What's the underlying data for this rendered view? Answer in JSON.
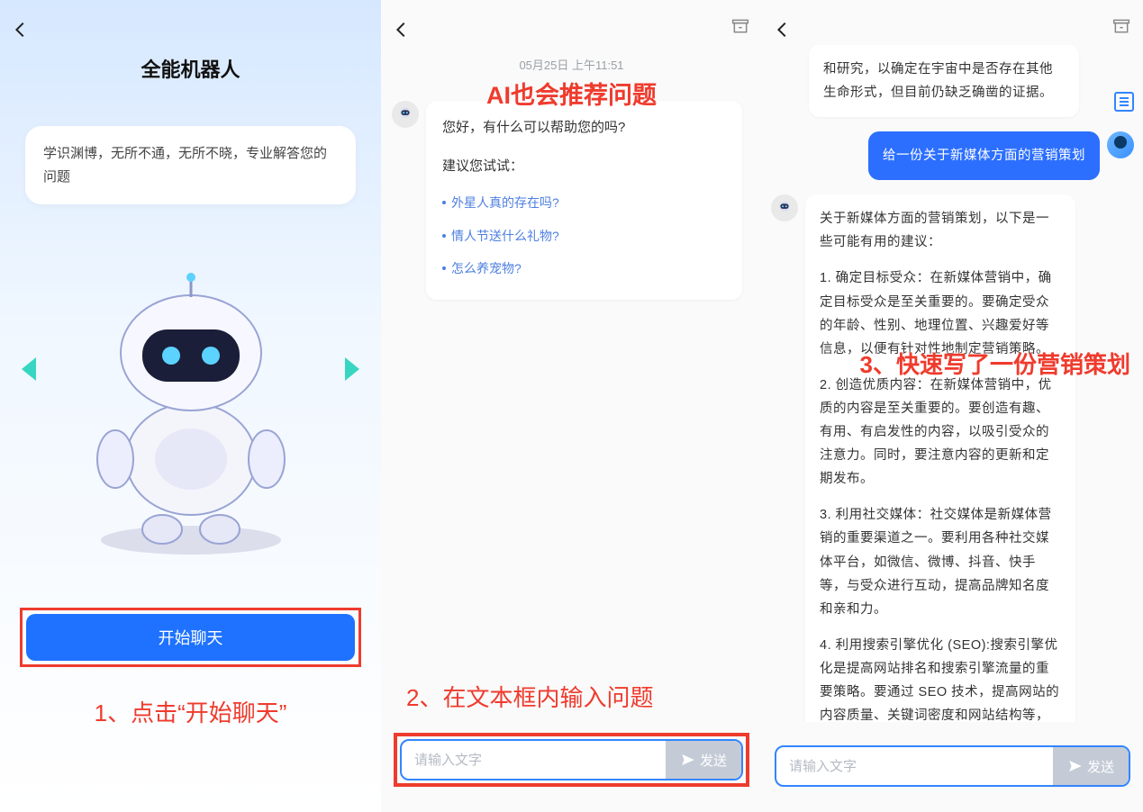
{
  "panel1": {
    "title": "全能机器人",
    "intro": "学识渊博，无所不通，无所不晓，专业解答您的问题",
    "start_button": "开始聊天",
    "caption": "1、点击“开始聊天”"
  },
  "panel2": {
    "timestamp": "05月25日  上午11:51",
    "overlay_text": "AI也会推荐问题",
    "greeting": "您好，有什么可以帮助您的吗?",
    "try_label": "建议您试试：",
    "suggestions": [
      "外星人真的存在吗?",
      "情人节送什么礼物?",
      "怎么养宠物?"
    ],
    "caption": "2、在文本框内输入问题",
    "input_placeholder": "请输入文字",
    "send_label": "发送"
  },
  "panel3": {
    "overlay_text": "3、快速写了一份营销策划",
    "prev_answer_tail": "和研究，以确定在宇宙中是否存在其他生命形式，但目前仍缺乏确凿的证据。",
    "user_msg": "给一份关于新媒体方面的营销策划",
    "bot_msg_intro": "关于新媒体方面的营销策划，以下是一些可能有用的建议：",
    "bot_msg_1": "1. 确定目标受众：在新媒体营销中，确定目标受众是至关重要的。要确定受众的年龄、性别、地理位置、兴趣爱好等信息，以便有针对性地制定营销策略。",
    "bot_msg_2": "2. 创造优质内容：在新媒体营销中，优质的内容是至关重要的。要创造有趣、有用、有启发性的内容，以吸引受众的注意力。同时，要注意内容的更新和定期发布。",
    "bot_msg_3": "3. 利用社交媒体：社交媒体是新媒体营销的重要渠道之一。要利用各种社交媒体平台，如微信、微博、抖音、快手等，与受众进行互动，提高品牌知名度和亲和力。",
    "bot_msg_4": "4. 利用搜索引擎优化 (SEO):搜索引擎优化是提高网站排名和搜索引擎流量的重要策略。要通过 SEO 技术，提高网站的内容质量、关键词密度和网站结构等，以提高网站的排名和流量。",
    "input_placeholder": "请输入文字",
    "send_label": "发送"
  }
}
